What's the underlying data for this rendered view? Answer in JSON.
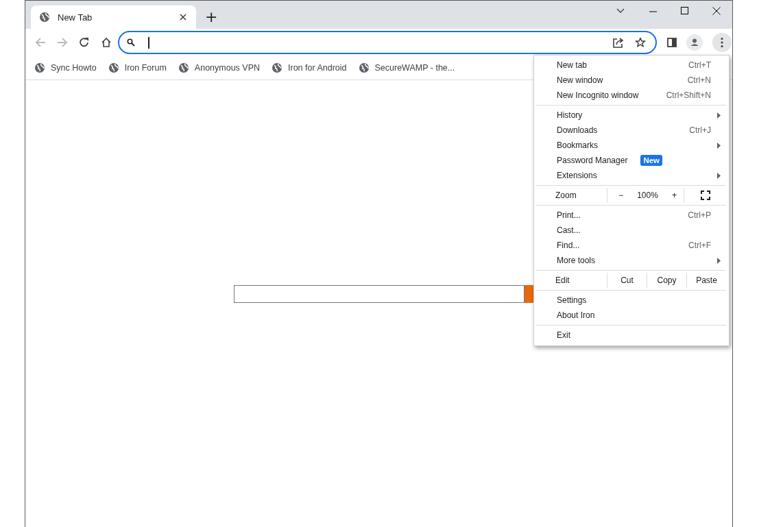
{
  "tabs": [
    {
      "title": "New Tab",
      "selected": true
    }
  ],
  "new_tab_button": "+",
  "toolbar": {
    "buttons": [
      {
        "kind": "back",
        "disabled": true
      },
      {
        "kind": "forward",
        "disabled": true
      },
      {
        "kind": "reload",
        "disabled": false
      },
      {
        "kind": "home",
        "disabled": false
      }
    ],
    "address": {
      "focused": true
    }
  },
  "bookmarks": [
    "Sync Howto",
    "Iron Forum",
    "Anonymous VPN",
    "Iron for Android",
    "SecureWAMP - the..."
  ],
  "menu": {
    "sections": [
      {
        "rows": [
          {
            "kind": "item",
            "label": "New tab",
            "shortcut": "Ctrl+T"
          },
          {
            "kind": "item",
            "label": "New window",
            "shortcut": "Ctrl+N"
          },
          {
            "kind": "item",
            "label": "New Incognito window",
            "shortcut": "Ctrl+Shift+N"
          }
        ]
      },
      {
        "rows": [
          {
            "kind": "item",
            "label": "History",
            "submenu": true
          },
          {
            "kind": "item",
            "label": "Downloads",
            "shortcut": "Ctrl+J"
          },
          {
            "kind": "item",
            "label": "Bookmarks",
            "submenu": true
          },
          {
            "kind": "item",
            "label": "Password Manager",
            "badge": "New"
          },
          {
            "kind": "item",
            "label": "Extensions",
            "submenu": true
          }
        ]
      },
      {
        "rows": [
          {
            "kind": "zoom",
            "label": "Zoom",
            "minus": "−",
            "value": "100%",
            "plus": "+"
          }
        ]
      },
      {
        "rows": [
          {
            "kind": "item",
            "label": "Print...",
            "shortcut": "Ctrl+P"
          },
          {
            "kind": "item",
            "label": "Cast..."
          },
          {
            "kind": "item",
            "label": "Find...",
            "shortcut": "Ctrl+F"
          },
          {
            "kind": "item",
            "label": "More tools",
            "submenu": true
          }
        ]
      },
      {
        "rows": [
          {
            "kind": "edit",
            "label": "Edit",
            "actions": [
              "Cut",
              "Copy",
              "Paste"
            ]
          }
        ]
      },
      {
        "rows": [
          {
            "kind": "item",
            "label": "Settings"
          },
          {
            "kind": "item",
            "label": "About Iron"
          }
        ]
      },
      {
        "rows": [
          {
            "kind": "item",
            "label": "Exit"
          }
        ]
      }
    ]
  }
}
